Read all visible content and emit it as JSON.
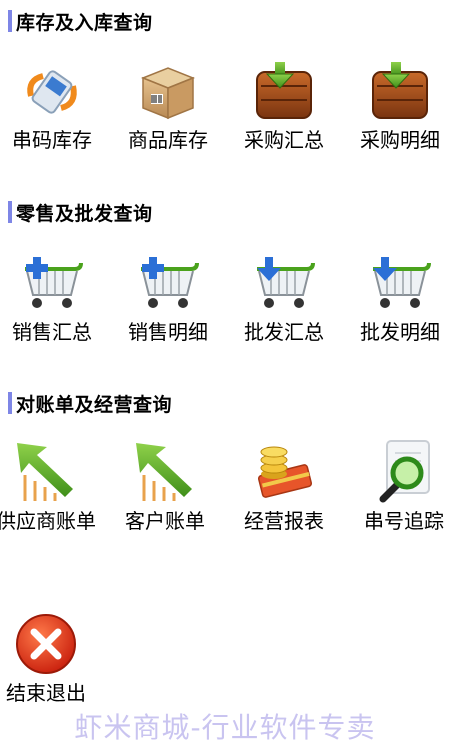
{
  "sections": [
    {
      "title": "库存及入库查询",
      "items": [
        "串码库存",
        "商品库存",
        "采购汇总",
        "采购明细"
      ]
    },
    {
      "title": "零售及批发查询",
      "items": [
        "销售汇总",
        "销售明细",
        "批发汇总",
        "批发明细"
      ]
    },
    {
      "title": "对账单及经营查询",
      "items": [
        "供应商账单",
        "客户账单",
        "经营报表",
        "串号追踪"
      ]
    }
  ],
  "exit_label": "结束退出",
  "watermark": "虾米商城-行业软件专卖",
  "colors": {
    "section_bar": "#7e86e6",
    "exit_red": "#e23b1a",
    "watermark": "#c9c4f0"
  }
}
